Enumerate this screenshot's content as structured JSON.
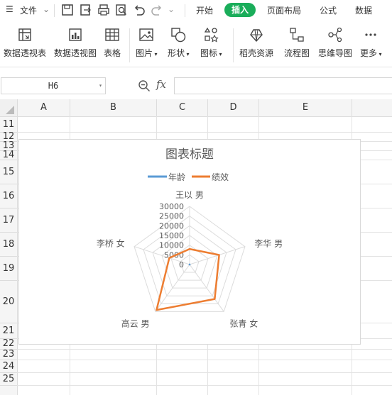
{
  "menubar": {
    "file_label": "文件",
    "tabs": [
      {
        "label": "开始"
      },
      {
        "label": "插入"
      },
      {
        "label": "页面布局"
      },
      {
        "label": "公式"
      },
      {
        "label": "数据"
      }
    ]
  },
  "ribbon": {
    "buttons": [
      {
        "label": "数据透视表"
      },
      {
        "label": "数据透视图"
      },
      {
        "label": "表格"
      },
      {
        "label": "图片"
      },
      {
        "label": "形状"
      },
      {
        "label": "图标"
      },
      {
        "label": "稻壳资源"
      },
      {
        "label": "流程图"
      },
      {
        "label": "思维导图"
      },
      {
        "label": "更多"
      }
    ]
  },
  "formula_bar": {
    "name_box": "H6",
    "fx_label": "fx",
    "formula": ""
  },
  "sheet": {
    "columns": [
      "A",
      "B",
      "C",
      "D",
      "E"
    ],
    "rows": [
      "11",
      "12",
      "13",
      "14",
      "15",
      "16",
      "17",
      "18",
      "19",
      "20",
      "21",
      "22",
      "23",
      "24",
      "25"
    ]
  },
  "colors": {
    "accent_green": "#1aad5a",
    "series_age": "#5b9bd5",
    "series_perf": "#ed7d31"
  },
  "chart_data": {
    "type": "radar",
    "title": "图表标题",
    "categories": [
      "王以 男",
      "李华 男",
      "张青 女",
      "高云 男",
      "李桥 女"
    ],
    "series": [
      {
        "name": "年龄",
        "values": [
          30,
          25,
          28,
          32,
          27
        ]
      },
      {
        "name": "绩效",
        "values": [
          8000,
          16000,
          22000,
          29000,
          11000
        ]
      }
    ],
    "ticks": [
      "0",
      "5000",
      "10000",
      "15000",
      "20000",
      "25000",
      "30000"
    ],
    "rmax": 30000,
    "legend": "top"
  }
}
